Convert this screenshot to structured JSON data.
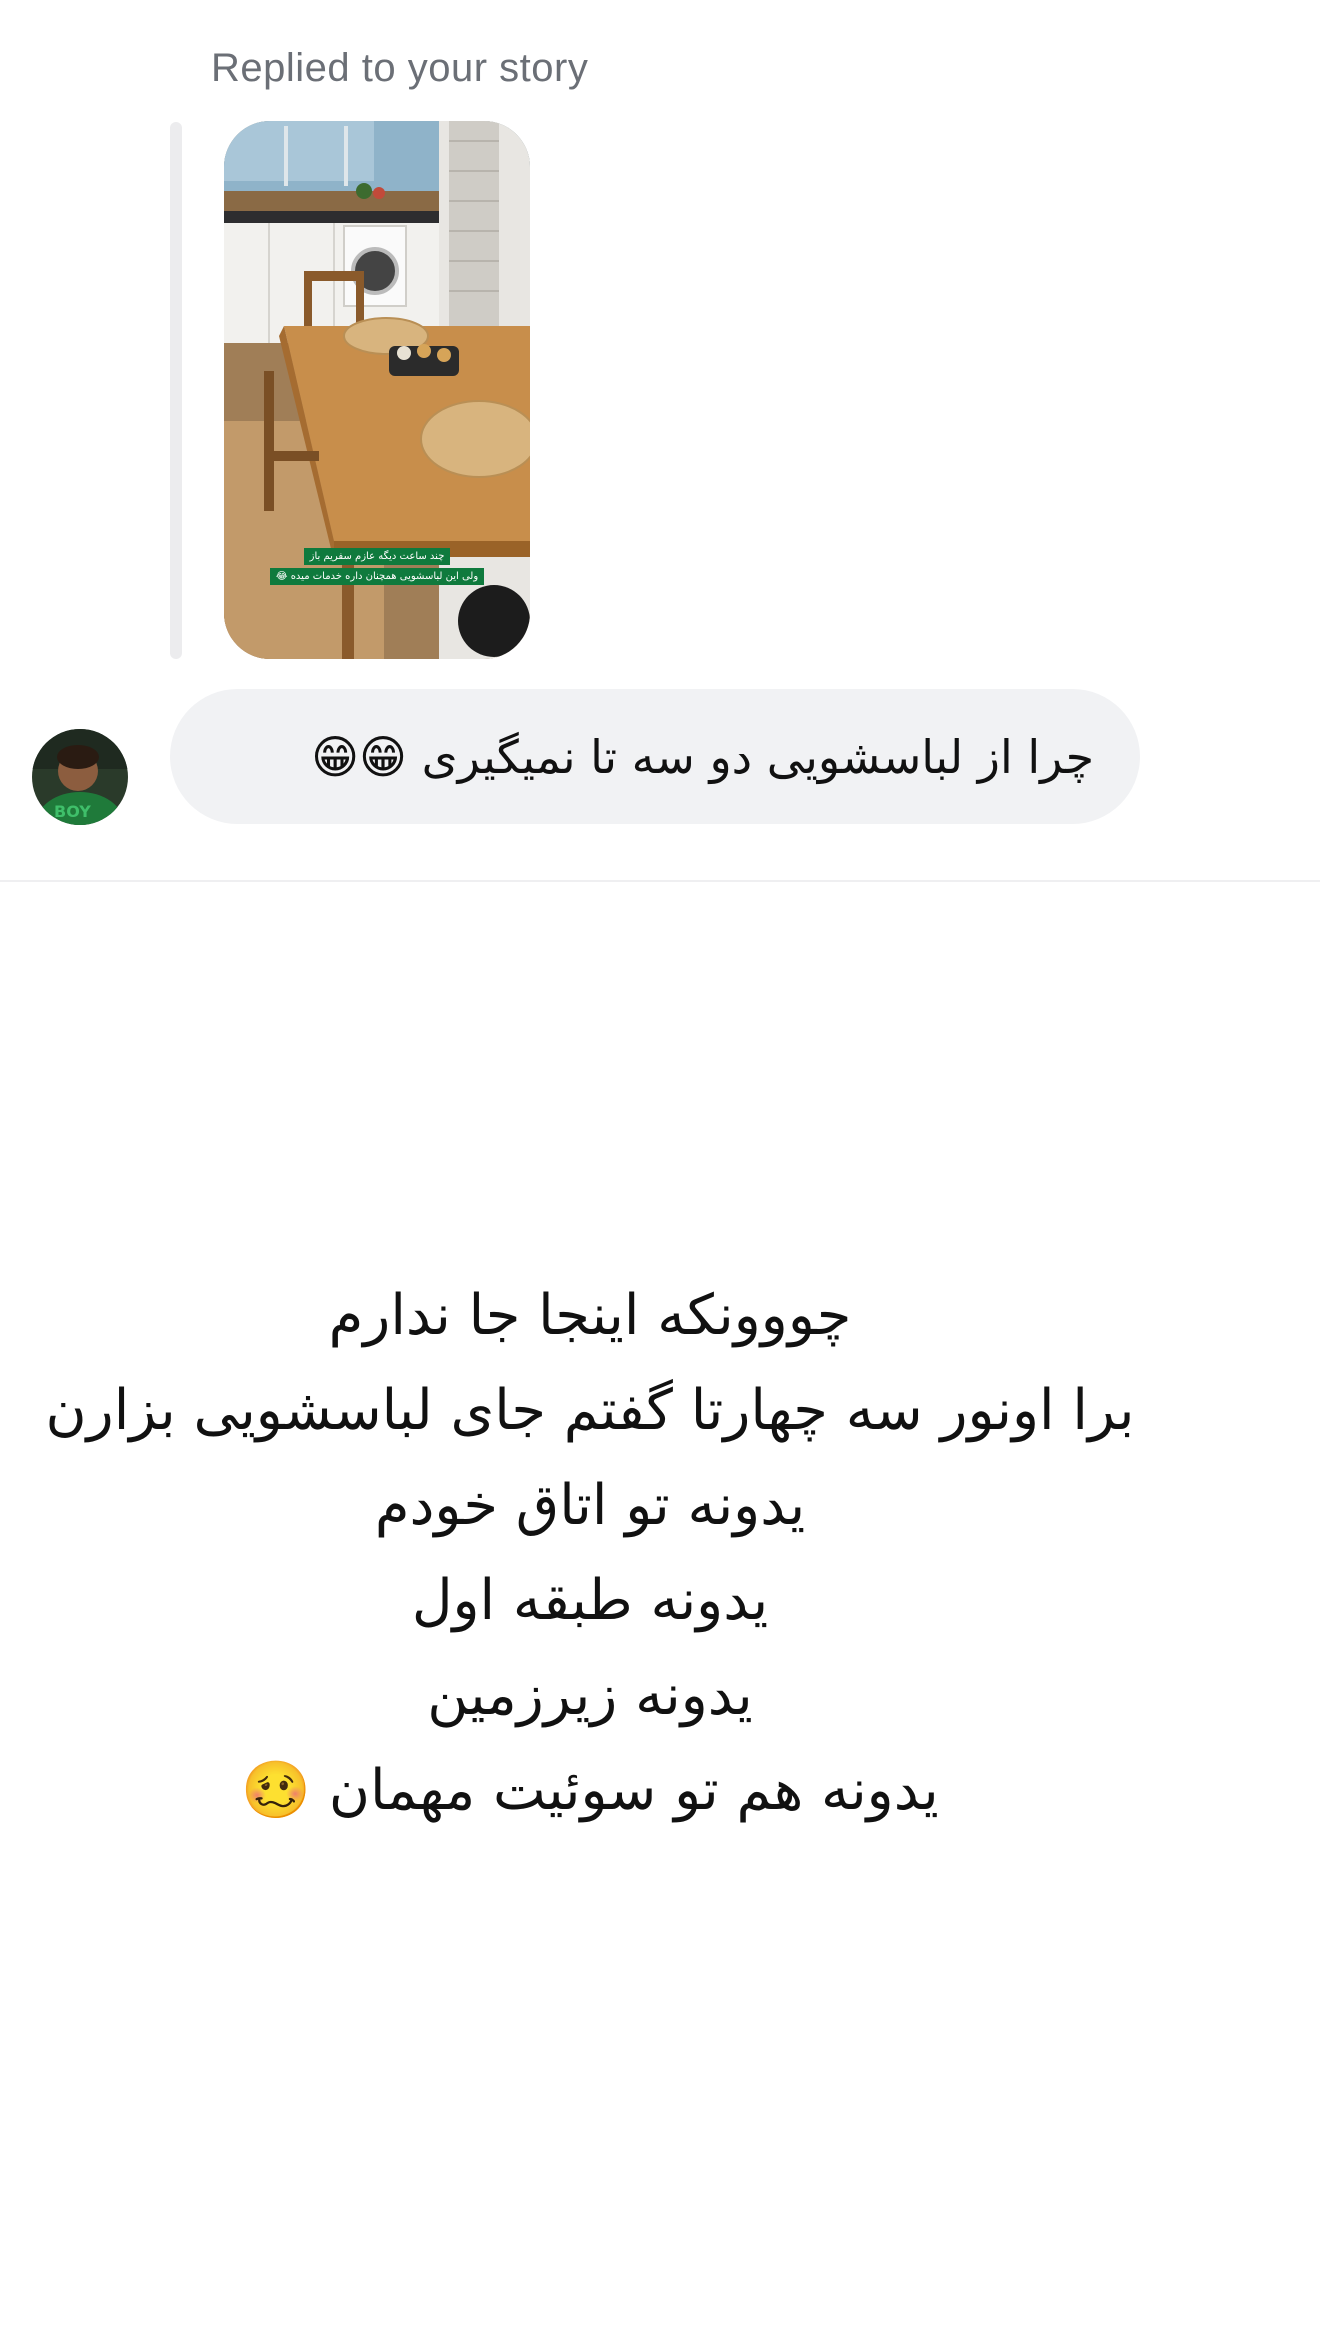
{
  "story_reply": {
    "label": "Replied to your story",
    "story_caption": {
      "line1": "چند ساعت دیگه عازم سفریم باز",
      "line2": "ولی این لباسشویی همچنان داره خدمات میده 😂"
    }
  },
  "message": {
    "text": "چرا از لباسشویی دو سه تا نمیگیری 😁😁"
  },
  "note": {
    "lines": [
      "چووونکه اینجا جا ندارم",
      "برا اونور سه چهارتا گفتم جای لباسشویی بزارن",
      "یدونه تو اتاق خودم",
      "یدونه طبقه اول",
      "یدونه زیرزمین",
      "یدونه هم تو سوئیت مهمان 🥴"
    ]
  },
  "colors": {
    "label_gray": "#6b6f76",
    "bubble_bg": "#f1f2f4",
    "reply_bar": "#ececee",
    "caption_green": "#0f7a3d"
  }
}
